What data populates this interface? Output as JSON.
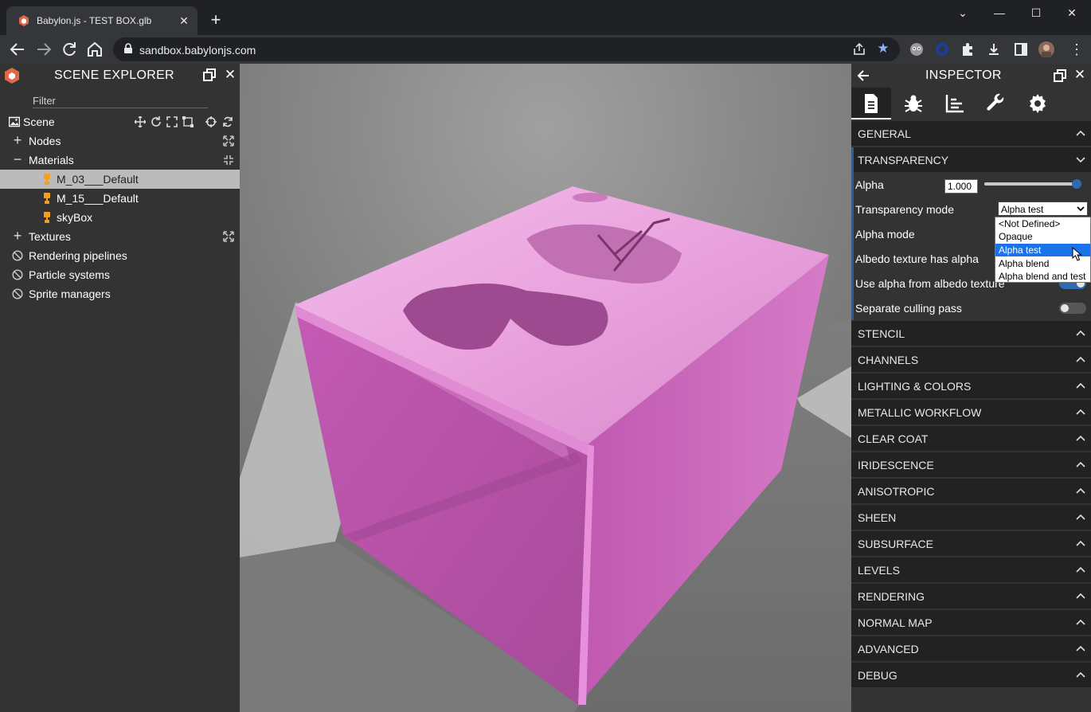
{
  "browser": {
    "tab_title": "Babylon.js - TEST BOX.glb",
    "url": "sandbox.babylonjs.com",
    "icons": [
      "back-icon",
      "forward-icon",
      "reload-icon",
      "home-icon",
      "lock-icon",
      "share-icon",
      "star-icon",
      "extension-icon",
      "download-icon",
      "side-panel-icon",
      "profile-avatar",
      "more-icon"
    ]
  },
  "explorer": {
    "title": "SCENE EXPLORER",
    "filter_placeholder": "Filter",
    "scene_label": "Scene",
    "nodes_label": "Nodes",
    "materials_label": "Materials",
    "materials": [
      "M_03___Default",
      "M_15___Default",
      "skyBox"
    ],
    "selected_material": "M_03___Default",
    "textures_label": "Textures",
    "rendering_pipelines_label": "Rendering pipelines",
    "particle_systems_label": "Particle systems",
    "sprite_managers_label": "Sprite managers"
  },
  "inspector": {
    "title": "INSPECTOR",
    "tabs": [
      "properties-tab",
      "debug-tab",
      "statistics-tab",
      "tools-tab",
      "settings-tab"
    ],
    "active_tab": "properties-tab",
    "general_label": "GENERAL",
    "transparency_label": "TRANSPARENCY",
    "alpha_label": "Alpha",
    "alpha_value": "1.000",
    "alpha_slider_fraction": 1.0,
    "transparency_mode_label": "Transparency mode",
    "transparency_mode_value": "Alpha test",
    "transparency_mode_options": [
      "<Not Defined>",
      "Opaque",
      "Alpha test",
      "Alpha blend",
      "Alpha blend and test"
    ],
    "alpha_mode_label": "Alpha mode",
    "albedo_has_alpha_label": "Albedo texture has alpha",
    "use_alpha_from_albedo_label": "Use alpha from albedo texture",
    "separate_culling_label": "Separate culling pass",
    "separate_culling_on": false,
    "sections": [
      "STENCIL",
      "CHANNELS",
      "LIGHTING & COLORS",
      "METALLIC WORKFLOW",
      "CLEAR COAT",
      "IRIDESCENCE",
      "ANISOTROPIC",
      "SHEEN",
      "SUBSURFACE",
      "LEVELS",
      "RENDERING",
      "NORMAL MAP",
      "ADVANCED",
      "DEBUG"
    ]
  },
  "colors": {
    "panel_bg": "#333333",
    "section_bg": "#222222",
    "accent_blue": "#1f5fa3",
    "cube_pink": "#d96bc8",
    "babylon_red": "#e0684b"
  }
}
